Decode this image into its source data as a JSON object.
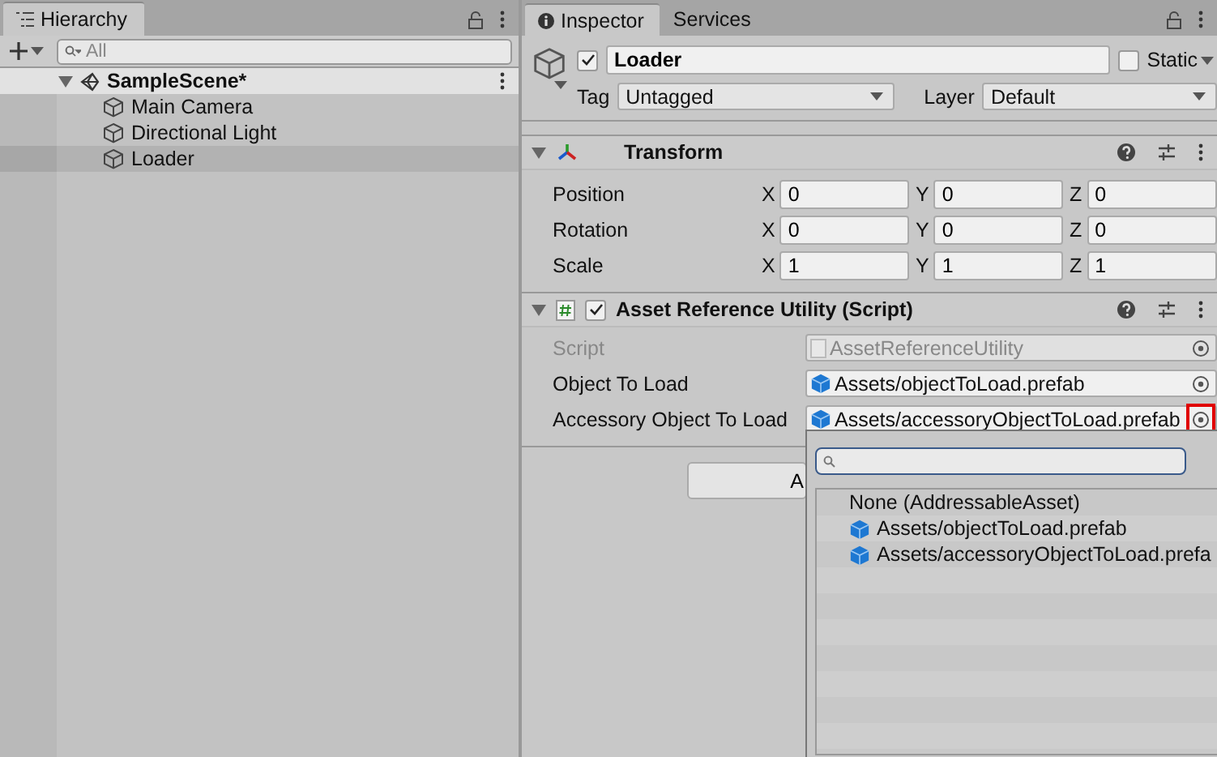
{
  "hierarchy": {
    "title": "Hierarchy",
    "search": {
      "placeholder": "All"
    },
    "scene": {
      "name": "SampleScene*",
      "expanded": true,
      "children": [
        {
          "name": "Main Camera",
          "selected": false
        },
        {
          "name": "Directional Light",
          "selected": false
        },
        {
          "name": "Loader",
          "selected": true
        }
      ]
    }
  },
  "inspector": {
    "tabs": [
      {
        "label": "Inspector",
        "selected": true
      },
      {
        "label": "Services",
        "selected": false
      }
    ],
    "object": {
      "active": true,
      "name": "Loader",
      "static_label": "Static",
      "static": false,
      "tag_label": "Tag",
      "tag": "Untagged",
      "layer_label": "Layer",
      "layer": "Default"
    },
    "components": [
      {
        "kind": "transform",
        "title": "Transform",
        "expanded": true,
        "rows": [
          {
            "label": "Position",
            "values": [
              {
                "axis": "X",
                "value": "0"
              },
              {
                "axis": "Y",
                "value": "0"
              },
              {
                "axis": "Z",
                "value": "0"
              }
            ]
          },
          {
            "label": "Rotation",
            "values": [
              {
                "axis": "X",
                "value": "0"
              },
              {
                "axis": "Y",
                "value": "0"
              },
              {
                "axis": "Z",
                "value": "0"
              }
            ]
          },
          {
            "label": "Scale",
            "values": [
              {
                "axis": "X",
                "value": "1"
              },
              {
                "axis": "Y",
                "value": "1"
              },
              {
                "axis": "Z",
                "value": "1"
              }
            ]
          }
        ]
      },
      {
        "kind": "script",
        "title": "Asset Reference Utility (Script)",
        "expanded": true,
        "enabled": true,
        "fields": [
          {
            "label": "Script",
            "value": "AssetReferenceUtility",
            "kind": "script",
            "disabled": true,
            "highlighted": false
          },
          {
            "label": "Object To Load",
            "value": "Assets/objectToLoad.prefab",
            "kind": "prefab",
            "disabled": false,
            "highlighted": false
          },
          {
            "label": "Accessory Object To Load",
            "value": "Assets/accessoryObjectToLoad.prefab",
            "kind": "prefab",
            "disabled": false,
            "highlighted": true
          }
        ]
      }
    ],
    "button": {
      "label": "A"
    },
    "popup": {
      "items": [
        {
          "label": "None (AddressableAsset)",
          "kind": "none"
        },
        {
          "label": "Assets/objectToLoad.prefab",
          "kind": "prefab"
        },
        {
          "label": "Assets/accessoryObjectToLoad.prefa",
          "kind": "prefab"
        }
      ]
    }
  }
}
